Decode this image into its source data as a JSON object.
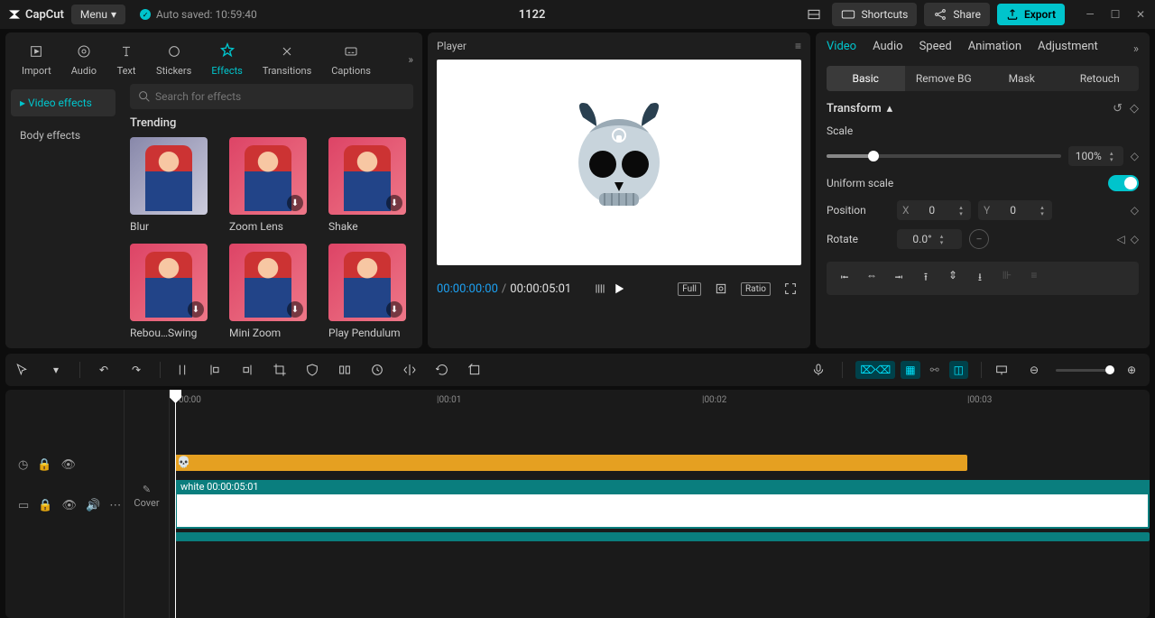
{
  "app": {
    "name": "CapCut",
    "menu": "Menu",
    "autosaved": "Auto saved: 10:59:40",
    "project": "1122"
  },
  "titlebar": {
    "shortcuts": "Shortcuts",
    "share": "Share",
    "export": "Export"
  },
  "media_tabs": {
    "import": "Import",
    "audio": "Audio",
    "text": "Text",
    "stickers": "Stickers",
    "effects": "Effects",
    "transitions": "Transitions",
    "captions": "Captions"
  },
  "effects_side": {
    "video": "Video effects",
    "body": "Body effects"
  },
  "effects": {
    "search_placeholder": "Search for effects",
    "trending": "Trending",
    "items": [
      {
        "label": "Blur"
      },
      {
        "label": "Zoom Lens"
      },
      {
        "label": "Shake"
      },
      {
        "label": "Rebou…Swing"
      },
      {
        "label": "Mini Zoom"
      },
      {
        "label": "Play Pendulum"
      }
    ]
  },
  "player": {
    "title": "Player",
    "cur": "00:00:00:00",
    "total": "00:00:05:01",
    "full": "Full",
    "ratio": "Ratio"
  },
  "inspector": {
    "tabs": {
      "video": "Video",
      "audio": "Audio",
      "speed": "Speed",
      "animation": "Animation",
      "adjustment": "Adjustment"
    },
    "subtabs": {
      "basic": "Basic",
      "removebg": "Remove BG",
      "mask": "Mask",
      "retouch": "Retouch"
    },
    "transform": "Transform",
    "scale": "Scale",
    "scale_val": "100%",
    "uniform": "Uniform scale",
    "position": "Position",
    "x": "X",
    "y": "Y",
    "x_val": "0",
    "y_val": "0",
    "rotate": "Rotate",
    "rotate_val": "0.0°"
  },
  "timeline": {
    "marks": [
      "00:00",
      "|00:01",
      "|00:02",
      "|00:03"
    ],
    "clip_label": "white  00:00:05:01",
    "cover": "Cover"
  }
}
